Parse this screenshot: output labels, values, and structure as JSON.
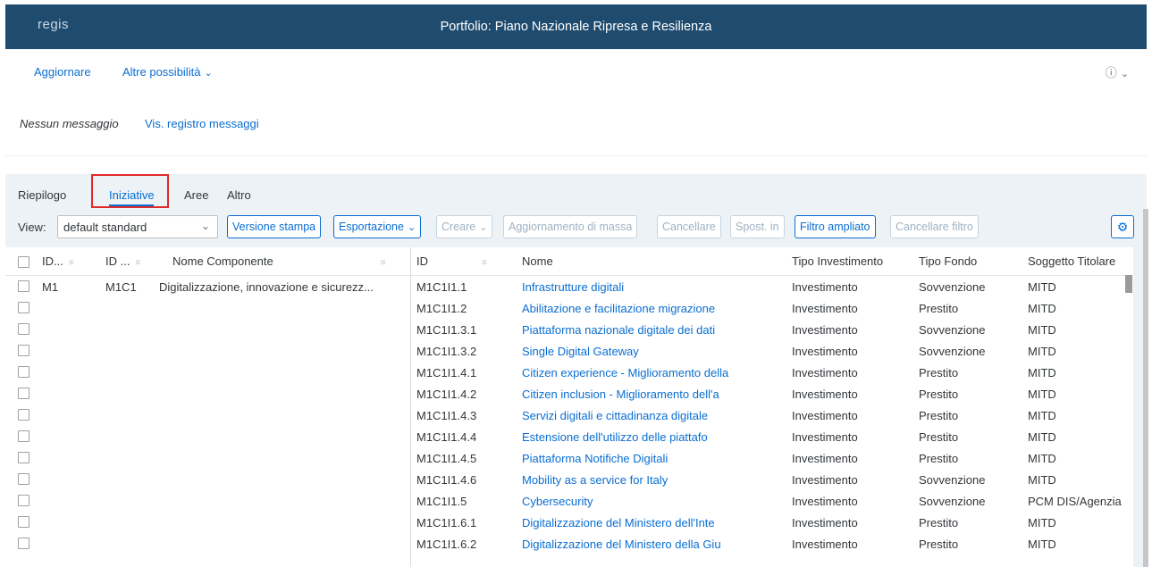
{
  "shell": {
    "logo": "regis",
    "title": "Portfolio: Piano Nazionale Ripresa e Resilienza"
  },
  "toolbar": {
    "refresh": "Aggiornare",
    "more": "Altre possibilità",
    "help_icon": "help-icon"
  },
  "messages": {
    "none": "Nessun messaggio",
    "log": "Vis. registro messaggi"
  },
  "tabs": [
    "Riepilogo",
    "Iniziative",
    "Aree",
    "Altro"
  ],
  "active_tab": "Iniziative",
  "table_toolbar": {
    "view_label": "View:",
    "view_value": "default standard",
    "print": "Versione stampa",
    "export": "Esportazione",
    "create": "Creare",
    "mass_update": "Aggiornamento di massa",
    "delete": "Cancellare",
    "move": "Spost. in",
    "extended_filter": "Filtro ampliato",
    "clear_filter": "Cancellare filtro"
  },
  "columns": {
    "id1": "ID...",
    "id2": "ID ...",
    "componente": "Nome Componente",
    "id": "ID",
    "nome": "Nome",
    "tipo_investimento": "Tipo Investimento",
    "tipo_fondo": "Tipo Fondo",
    "soggetto": "Soggetto Titolare"
  },
  "rows": [
    {
      "id1": "M1",
      "id2": "M1C1",
      "componente": "Digitalizzazione, innovazione e sicurezz...",
      "id": "M1C1I1.1",
      "nome": "Infrastrutture digitali",
      "tipo_investimento": "Investimento",
      "tipo_fondo": "Sovvenzione",
      "soggetto": "MITD"
    },
    {
      "id1": "",
      "id2": "",
      "componente": "",
      "id": "M1C1I1.2",
      "nome": "Abilitazione e facilitazione migrazione",
      "tipo_investimento": "Investimento",
      "tipo_fondo": "Prestito",
      "soggetto": "MITD"
    },
    {
      "id1": "",
      "id2": "",
      "componente": "",
      "id": "M1C1I1.3.1",
      "nome": "Piattaforma nazionale digitale dei dati",
      "tipo_investimento": "Investimento",
      "tipo_fondo": "Sovvenzione",
      "soggetto": "MITD"
    },
    {
      "id1": "",
      "id2": "",
      "componente": "",
      "id": "M1C1I1.3.2",
      "nome": " Single Digital Gateway",
      "tipo_investimento": "Investimento",
      "tipo_fondo": "Sovvenzione",
      "soggetto": "MITD"
    },
    {
      "id1": "",
      "id2": "",
      "componente": "",
      "id": "M1C1I1.4.1",
      "nome": "Citizen experience - Miglioramento della",
      "tipo_investimento": "Investimento",
      "tipo_fondo": "Prestito",
      "soggetto": "MITD"
    },
    {
      "id1": "",
      "id2": "",
      "componente": "",
      "id": "M1C1I1.4.2",
      "nome": "Citizen inclusion - Miglioramento dell'a",
      "tipo_investimento": "Investimento",
      "tipo_fondo": "Prestito",
      "soggetto": "MITD"
    },
    {
      "id1": "",
      "id2": "",
      "componente": "",
      "id": "M1C1I1.4.3",
      "nome": "Servizi digitali e cittadinanza digitale",
      "tipo_investimento": "Investimento",
      "tipo_fondo": "Prestito",
      "soggetto": "MITD"
    },
    {
      "id1": "",
      "id2": "",
      "componente": "",
      "id": "M1C1I1.4.4",
      "nome": " Estensione dell'utilizzo delle piattafo",
      "tipo_investimento": "Investimento",
      "tipo_fondo": "Prestito",
      "soggetto": "MITD"
    },
    {
      "id1": "",
      "id2": "",
      "componente": "",
      "id": "M1C1I1.4.5",
      "nome": " Piattaforma Notifiche Digitali",
      "tipo_investimento": "Investimento",
      "tipo_fondo": "Prestito",
      "soggetto": "MITD"
    },
    {
      "id1": "",
      "id2": "",
      "componente": "",
      "id": "M1C1I1.4.6",
      "nome": " Mobility as a service for Italy",
      "tipo_investimento": "Investimento",
      "tipo_fondo": "Sovvenzione",
      "soggetto": "MITD"
    },
    {
      "id1": "",
      "id2": "",
      "componente": "",
      "id": "M1C1I1.5",
      "nome": "Cybersecurity",
      "tipo_investimento": "Investimento",
      "tipo_fondo": "Sovvenzione",
      "soggetto": "PCM DIS/Agenzia"
    },
    {
      "id1": "",
      "id2": "",
      "componente": "",
      "id": "M1C1I1.6.1",
      "nome": "Digitalizzazione del Ministero dell'Inte",
      "tipo_investimento": "Investimento",
      "tipo_fondo": "Prestito",
      "soggetto": "MITD"
    },
    {
      "id1": "",
      "id2": "",
      "componente": "",
      "id": "M1C1I1.6.2",
      "nome": "Digitalizzazione del Ministero della Giu",
      "tipo_investimento": "Investimento",
      "tipo_fondo": "Prestito",
      "soggetto": "MITD"
    }
  ]
}
